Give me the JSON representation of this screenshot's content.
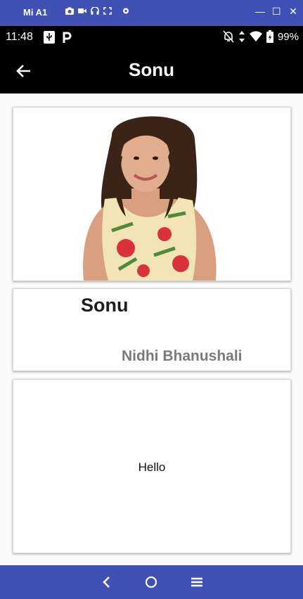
{
  "window": {
    "title": "Mi A1"
  },
  "status_bar": {
    "time": "11:48",
    "battery": "99%"
  },
  "app_bar": {
    "title": "Sonu"
  },
  "character_card": {
    "name": "Sonu",
    "actor": "Nidhi Bhanushali"
  },
  "message_card": {
    "text": "Hello"
  },
  "colors": {
    "window_bar": "#3f51b5",
    "app_bar": "#000000",
    "card_border": "#d6d6d6",
    "actor_text": "#7a7a7a"
  },
  "icons": [
    "camera-icon",
    "video-icon",
    "headset-icon",
    "fullscreen-icon",
    "settings-icon",
    "usb-icon",
    "parking-icon",
    "mute-icon",
    "signal-icon",
    "wifi-icon",
    "battery-icon",
    "back-arrow-icon",
    "nav-back-icon",
    "nav-home-icon",
    "nav-menu-icon"
  ]
}
